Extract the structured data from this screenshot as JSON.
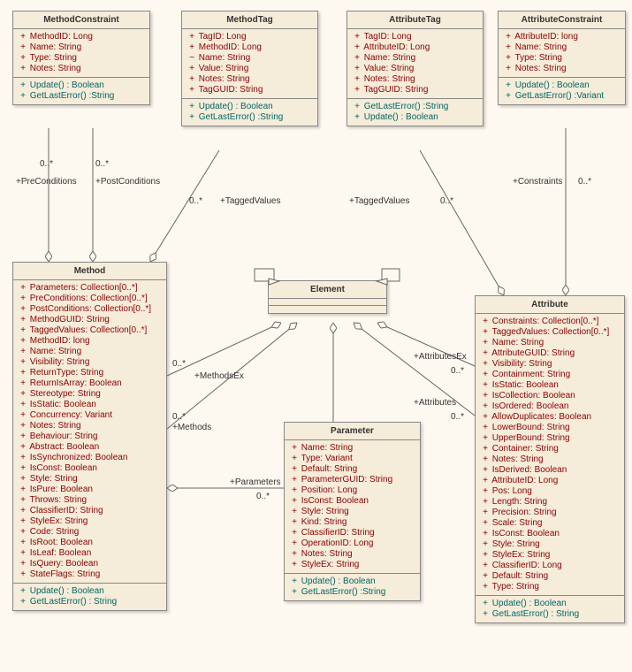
{
  "classes": {
    "methodConstraint": {
      "name": "MethodConstraint",
      "attrs": [
        {
          "v": "+",
          "t": "MethodID: Long"
        },
        {
          "v": "+",
          "t": "Name: String"
        },
        {
          "v": "+",
          "t": "Type: String"
        },
        {
          "v": "+",
          "t": "Notes: String"
        }
      ],
      "ops": [
        {
          "v": "+",
          "t": "Update() : Boolean"
        },
        {
          "v": "+",
          "t": "GetLastError() :String"
        }
      ]
    },
    "methodTag": {
      "name": "MethodTag",
      "attrs": [
        {
          "v": "+",
          "t": "TagID: Long"
        },
        {
          "v": "+",
          "t": "MethodID: Long"
        },
        {
          "v": "~",
          "t": "Name: String"
        },
        {
          "v": "+",
          "t": "Value: String"
        },
        {
          "v": "+",
          "t": "Notes: String"
        },
        {
          "v": "+",
          "t": "TagGUID: String"
        }
      ],
      "ops": [
        {
          "v": "+",
          "t": "Update() : Boolean"
        },
        {
          "v": "+",
          "t": "GetLastError() :String"
        }
      ]
    },
    "attributeTag": {
      "name": "AttributeTag",
      "attrs": [
        {
          "v": "+",
          "t": "TagID: Long"
        },
        {
          "v": "+",
          "t": "AttributeID: Long"
        },
        {
          "v": "+",
          "t": "Name: String"
        },
        {
          "v": "+",
          "t": "Value: String"
        },
        {
          "v": "+",
          "t": "Notes: String"
        },
        {
          "v": "+",
          "t": "TagGUID: String"
        }
      ],
      "ops": [
        {
          "v": "+",
          "t": "GetLastError() :String"
        },
        {
          "v": "+",
          "t": "Update() : Boolean"
        }
      ]
    },
    "attributeConstraint": {
      "name": "AttributeConstraint",
      "attrs": [
        {
          "v": "+",
          "t": "AttributeID: long"
        },
        {
          "v": "+",
          "t": "Name: String"
        },
        {
          "v": "+",
          "t": "Type: String"
        },
        {
          "v": "+",
          "t": "Notes: String"
        }
      ],
      "ops": [
        {
          "v": "+",
          "t": "Update() : Boolean"
        },
        {
          "v": "+",
          "t": "GetLastError() :Variant"
        }
      ]
    },
    "method": {
      "name": "Method",
      "attrs": [
        {
          "v": "+",
          "t": "Parameters: Collection[0..*]"
        },
        {
          "v": "+",
          "t": "PreConditions: Collection[0..*]"
        },
        {
          "v": "+",
          "t": "PostConditions: Collection[0..*]"
        },
        {
          "v": "+",
          "t": "MethodGUID: String"
        },
        {
          "v": "+",
          "t": "TaggedValues: Collection[0..*]"
        },
        {
          "v": "+",
          "t": "MethodID: long"
        },
        {
          "v": "+",
          "t": "Name: String"
        },
        {
          "v": "+",
          "t": "Visibility: String"
        },
        {
          "v": "+",
          "t": "ReturnType: String"
        },
        {
          "v": "+",
          "t": "ReturnIsArray: Boolean"
        },
        {
          "v": "+",
          "t": "Stereotype: String"
        },
        {
          "v": "+",
          "t": "IsStatic: Boolean"
        },
        {
          "v": "+",
          "t": "Concurrency: Variant"
        },
        {
          "v": "+",
          "t": "Notes: String"
        },
        {
          "v": "+",
          "t": "Behaviour: String"
        },
        {
          "v": "+",
          "t": "Abstract: Boolean"
        },
        {
          "v": "+",
          "t": "IsSynchronized: Boolean"
        },
        {
          "v": "+",
          "t": "IsConst: Boolean"
        },
        {
          "v": "+",
          "t": "Style: String"
        },
        {
          "v": "+",
          "t": "IsPure: Boolean"
        },
        {
          "v": "+",
          "t": "Throws: String"
        },
        {
          "v": "+",
          "t": "ClassifierID: String"
        },
        {
          "v": "+",
          "t": "StyleEx: String"
        },
        {
          "v": "+",
          "t": "Code: String"
        },
        {
          "v": "+",
          "t": "IsRoot: Boolean"
        },
        {
          "v": "+",
          "t": "IsLeaf: Boolean"
        },
        {
          "v": "+",
          "t": "IsQuery: Boolean"
        },
        {
          "v": "+",
          "t": "StateFlags: String"
        }
      ],
      "ops": [
        {
          "v": "+",
          "t": "Update() : Boolean"
        },
        {
          "v": "+",
          "t": "GetLastError() : String"
        }
      ]
    },
    "element": {
      "name": "Element"
    },
    "parameter": {
      "name": "Parameter",
      "attrs": [
        {
          "v": "+",
          "t": "Name: String"
        },
        {
          "v": "+",
          "t": "Type: Variant"
        },
        {
          "v": "+",
          "t": "Default: String"
        },
        {
          "v": "+",
          "t": "ParameterGUID: String"
        },
        {
          "v": "+",
          "t": "Position: Long"
        },
        {
          "v": "+",
          "t": "IsConst: Boolean"
        },
        {
          "v": "+",
          "t": "Style: String"
        },
        {
          "v": "+",
          "t": "Kind: String"
        },
        {
          "v": "+",
          "t": "ClassifierID: String"
        },
        {
          "v": "+",
          "t": "OperationID: Long"
        },
        {
          "v": "+",
          "t": "Notes: String"
        },
        {
          "v": "+",
          "t": "StyleEx: String"
        }
      ],
      "ops": [
        {
          "v": "+",
          "t": "Update() : Boolean"
        },
        {
          "v": "+",
          "t": "GetLastError() :String"
        }
      ]
    },
    "attribute": {
      "name": "Attribute",
      "attrs": [
        {
          "v": "+",
          "t": "Constraints: Collection[0..*]"
        },
        {
          "v": "+",
          "t": "TaggedValues: Collection[0..*]"
        },
        {
          "v": "+",
          "t": "Name: String"
        },
        {
          "v": "+",
          "t": "AttributeGUID: String"
        },
        {
          "v": "+",
          "t": "Visibility: String"
        },
        {
          "v": "+",
          "t": "Containment: String"
        },
        {
          "v": "+",
          "t": "IsStatic: Boolean"
        },
        {
          "v": "+",
          "t": "IsCollection: Boolean"
        },
        {
          "v": "+",
          "t": "IsOrdered: Boolean"
        },
        {
          "v": "+",
          "t": "AllowDuplicates: Boolean"
        },
        {
          "v": "+",
          "t": "LowerBound: String"
        },
        {
          "v": "+",
          "t": "UpperBound: String"
        },
        {
          "v": "+",
          "t": "Container: String"
        },
        {
          "v": "+",
          "t": "Notes: String"
        },
        {
          "v": "+",
          "t": "IsDerived: Boolean"
        },
        {
          "v": "+",
          "t": "AttributeID: Long"
        },
        {
          "v": "+",
          "t": "Pos: Long"
        },
        {
          "v": "+",
          "t": "Length: String"
        },
        {
          "v": "+",
          "t": "Precision: String"
        },
        {
          "v": "+",
          "t": "Scale: String"
        },
        {
          "v": "+",
          "t": "IsConst: Boolean"
        },
        {
          "v": "+",
          "t": "Style: String"
        },
        {
          "v": "+",
          "t": "StyleEx: String"
        },
        {
          "v": "+",
          "t": "ClassifierID: Long"
        },
        {
          "v": "+",
          "t": "Default: String"
        },
        {
          "v": "+",
          "t": "Type: String"
        }
      ],
      "ops": [
        {
          "v": "+",
          "t": "Update() : Boolean"
        },
        {
          "v": "+",
          "t": "GetLastError() : String"
        }
      ]
    }
  },
  "labels": {
    "preConditions": "+PreConditions",
    "postConditions": "+PostConditions",
    "taggedValues": "+TaggedValues",
    "constraints": "+Constraints",
    "methodsEx": "+MethodsEx",
    "methods": "+Methods",
    "attributesEx": "+AttributesEx",
    "attributes": "+Attributes",
    "parameters": "+Parameters",
    "m0": "0..*"
  }
}
